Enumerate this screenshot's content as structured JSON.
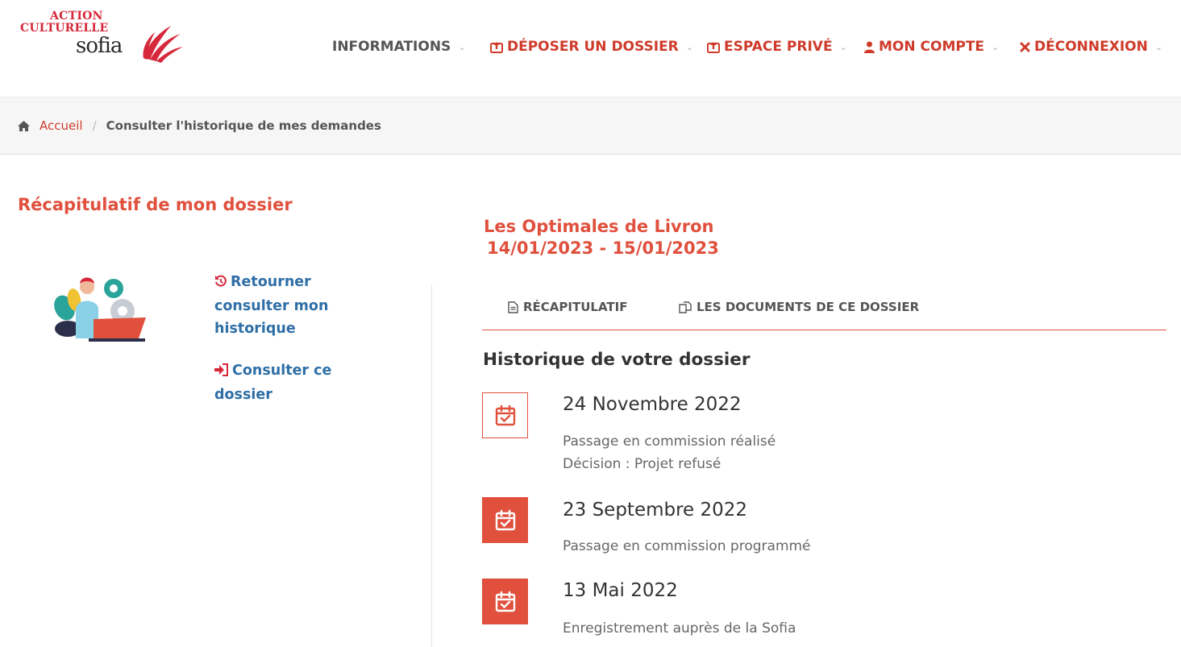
{
  "logo": {
    "line1": "ACTION",
    "line2": "CULTURELLE",
    "line3": "sofia"
  },
  "nav": {
    "informations": "INFORMATIONS",
    "deposer": "DÉPOSER UN DOSSIER",
    "espace": "ESPACE PRIVÉ",
    "compte": "MON COMPTE",
    "deconnexion": "DÉCONNEXION"
  },
  "breadcrumb": {
    "home": "Accueil",
    "current": "Consulter l'historique de mes demandes"
  },
  "sidebar": {
    "title": "Récapitulatif de mon dossier",
    "links": [
      "Retourner consulter mon historique",
      "Consulter ce dossier"
    ]
  },
  "event": {
    "name": "Les Optimales de Livron",
    "dates": "14/01/2023 - 15/01/2023"
  },
  "tabs": [
    "RÉCAPITULATIF",
    "LES DOCUMENTS DE CE DOSSIER"
  ],
  "history": {
    "title": "Historique de votre dossier",
    "entries": [
      {
        "date": "24 Novembre 2022",
        "lines": [
          "Passage en commission réalisé",
          "Décision : Projet refusé"
        ]
      },
      {
        "date": "23 Septembre 2022",
        "lines": [
          "Passage en commission programmé"
        ]
      },
      {
        "date": "13 Mai 2022",
        "lines": [
          "Enregistrement auprès de la Sofia"
        ]
      }
    ]
  },
  "colors": {
    "accent": "#e0503d",
    "nav_red": "#cf3b2b",
    "link_blue": "#2f6fa6"
  },
  "icons": [
    "home-icon",
    "upload-icon",
    "user-icon",
    "times-icon",
    "chevron-down-icon",
    "history-icon",
    "sign-in-icon",
    "file-icon",
    "copy-icon",
    "calendar-check-icon"
  ]
}
